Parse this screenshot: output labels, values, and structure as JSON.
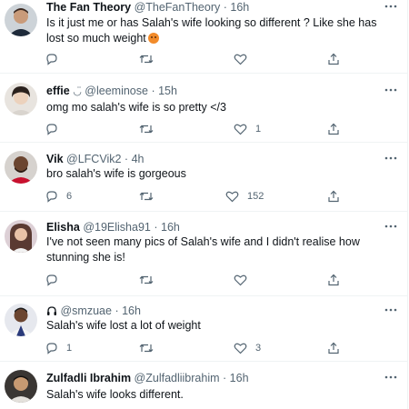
{
  "tweets": [
    {
      "name": "The Fan Theory",
      "handle": "@TheFanTheory",
      "sep": "·",
      "time": "16h",
      "text": "Is it just me or has Salah's wife looking so different ? Like she has lost so much weight",
      "replies": "",
      "retweets": "",
      "likes": ""
    },
    {
      "name": "effie",
      "name_suffix": "◡̈",
      "handle": "@leeminose",
      "sep": "·",
      "time": "15h",
      "text": "omg mo salah's wife is so pretty </3",
      "replies": "",
      "retweets": "",
      "likes": "1"
    },
    {
      "name": "Vik",
      "handle": "@LFCVik2",
      "sep": "·",
      "time": "4h",
      "text": "bro salah's wife is gorgeous",
      "replies": "6",
      "retweets": "",
      "likes": "152"
    },
    {
      "name": "Elisha",
      "handle": "@19Elisha91",
      "sep": "·",
      "time": "16h",
      "text": "I've not seen many pics of Salah's wife and I didn't realise how stunning she is!",
      "replies": "",
      "retweets": "",
      "likes": ""
    },
    {
      "name": "",
      "handle": "@smzuae",
      "sep": "·",
      "time": "16h",
      "text": "Salah's wife lost a lot of weight",
      "replies": "1",
      "retweets": "",
      "likes": "3"
    },
    {
      "name": "Zulfadli Ibrahim",
      "handle": "@Zulfadliibrahim",
      "sep": "·",
      "time": "16h",
      "text": "Salah's wife looks different.",
      "replies": "",
      "retweets": "",
      "likes": ""
    }
  ],
  "icons": {
    "more": "more-icon",
    "reply": "reply-icon",
    "retweet": "retweet-icon",
    "like": "like-icon",
    "share": "share-icon"
  },
  "colors": {
    "name_text": "#0f1419",
    "muted_text": "#536471",
    "divider": "#eff3f4"
  }
}
